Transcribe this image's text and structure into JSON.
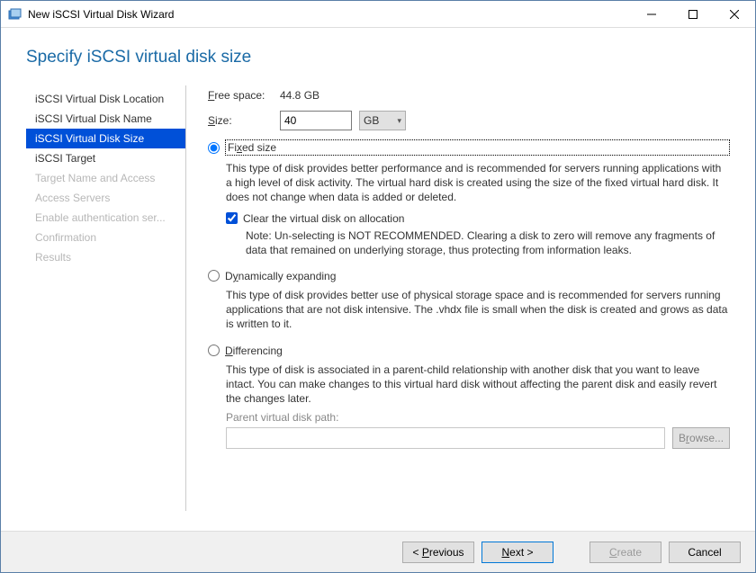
{
  "window": {
    "title": "New iSCSI Virtual Disk Wizard"
  },
  "page": {
    "title": "Specify iSCSI virtual disk size"
  },
  "nav": {
    "items": [
      {
        "label": "iSCSI Virtual Disk Location",
        "state": "normal"
      },
      {
        "label": "iSCSI Virtual Disk Name",
        "state": "normal"
      },
      {
        "label": "iSCSI Virtual Disk Size",
        "state": "selected"
      },
      {
        "label": "iSCSI Target",
        "state": "normal"
      },
      {
        "label": "Target Name and Access",
        "state": "disabled"
      },
      {
        "label": "Access Servers",
        "state": "disabled"
      },
      {
        "label": "Enable authentication ser...",
        "state": "disabled"
      },
      {
        "label": "Confirmation",
        "state": "disabled"
      },
      {
        "label": "Results",
        "state": "disabled"
      }
    ]
  },
  "main": {
    "free_space_label_pre": "F",
    "free_space_label_post": "ree space:",
    "free_space_value": "44.8 GB",
    "size_label_pre": "S",
    "size_label_post": "ize:",
    "size_value": "40",
    "size_unit": "GB",
    "fixed": {
      "label_pre": "Fi",
      "label_hot": "x",
      "label_post": "ed size",
      "desc": "This type of disk provides better performance and is recommended for servers running applications with a high level of disk activity. The virtual hard disk is created using the size of the fixed virtual hard disk. It does not change when data is added or deleted.",
      "clear_label": "Clear the virtual disk on allocation",
      "clear_note": "Note: Un-selecting is NOT RECOMMENDED. Clearing a disk to zero will remove any fragments of data that remained on underlying storage, thus protecting from information leaks."
    },
    "dynamic": {
      "label_pre": "D",
      "label_hot": "y",
      "label_post": "namically expanding",
      "desc": "This type of disk provides better use of physical storage space and is recommended for servers running applications that are not disk intensive. The .vhdx file is small when the disk is created and grows as data is written to it."
    },
    "diff": {
      "label_pre": "D",
      "label_post": "ifferencing",
      "desc": "This type of disk is associated in a parent-child relationship with another disk that you want to leave intact. You can make changes to this virtual hard disk without affecting the parent disk and easily revert the changes later.",
      "path_label": "Parent virtual disk path:",
      "path_value": "",
      "browse_pre": "B",
      "browse_hot": "r",
      "browse_post": "owse..."
    }
  },
  "footer": {
    "previous_pre": "< ",
    "previous_hot": "P",
    "previous_post": "revious",
    "next_pre": "",
    "next_hot": "N",
    "next_post": "ext >",
    "create_pre": "",
    "create_hot": "C",
    "create_post": "reate",
    "cancel": "Cancel"
  }
}
